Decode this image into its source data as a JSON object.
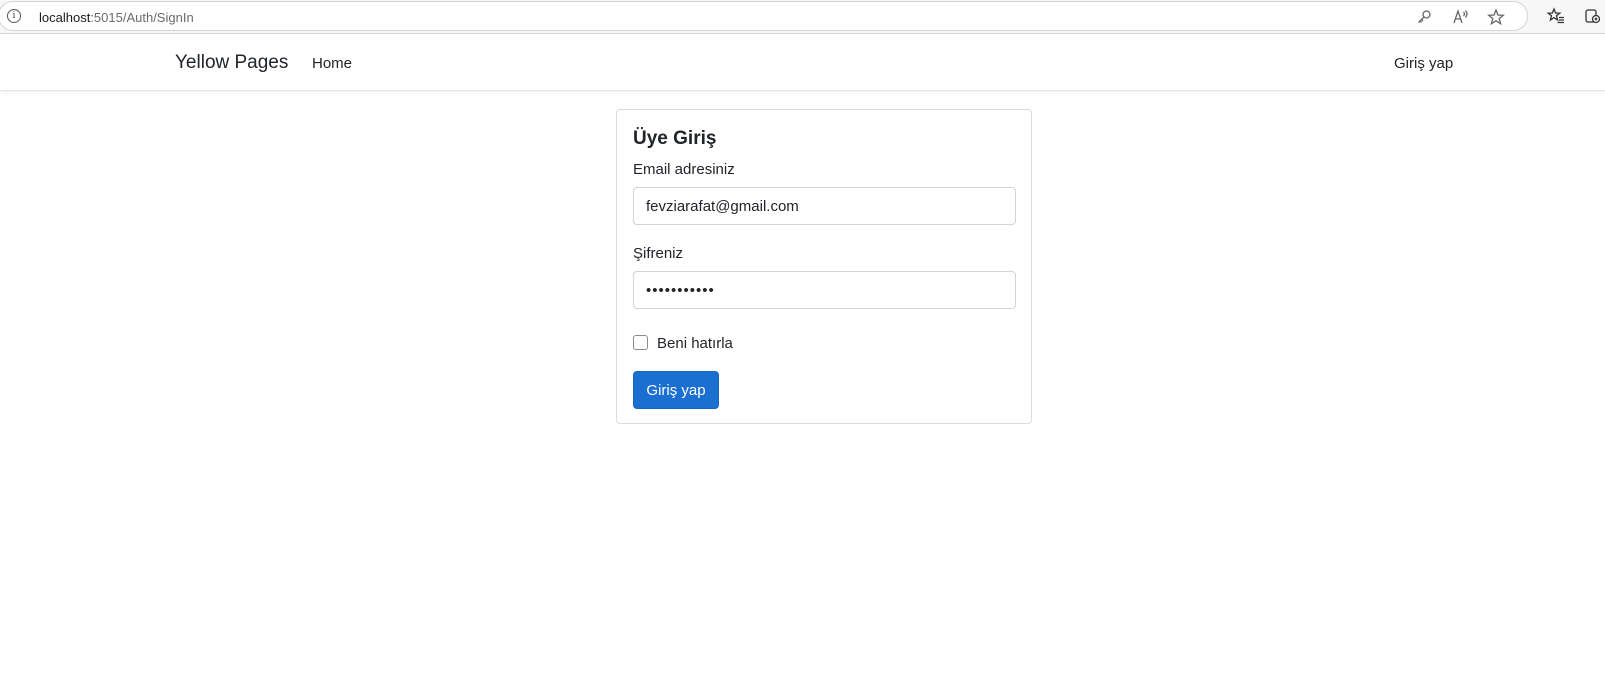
{
  "browser": {
    "url_host": "localhost",
    "url_path": ":5015/Auth/SignIn"
  },
  "navbar": {
    "brand": "Yellow Pages",
    "home_link": "Home",
    "signin_link": "Giriş yap"
  },
  "form": {
    "title": "Üye Giriş",
    "email_label": "Email adresiniz",
    "email_value": "fevziarafat@gmail.com",
    "password_label": "Şifreniz",
    "password_value": "fevziarafat",
    "remember_label": "Beni hatırla",
    "remember_checked": false,
    "submit_label": "Giriş yap"
  },
  "colors": {
    "primary_button": "#1a6fd1",
    "card_border": "#dcdcdc"
  }
}
